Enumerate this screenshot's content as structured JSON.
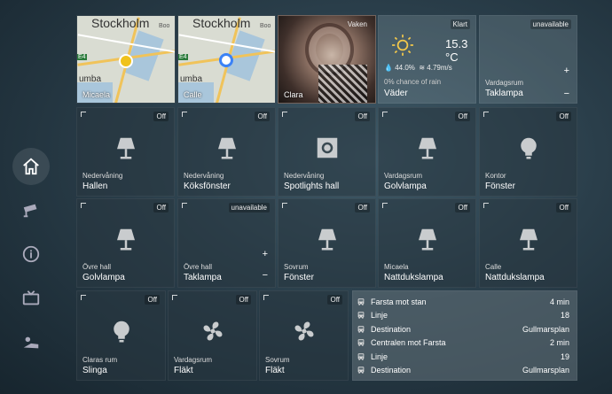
{
  "tiles": {
    "map1": {
      "label": "Micaela",
      "city": "Stockholm",
      "small": "Boo",
      "umba": "umba",
      "badge": "E4"
    },
    "map2": {
      "label": "Calle",
      "city": "Stockholm",
      "small": "Boo",
      "umba": "umba",
      "badge": "E4"
    },
    "camera": {
      "label": "Clara",
      "state": "Vaken"
    },
    "weather": {
      "state": "Klart",
      "temp": "15.3 °C",
      "humidity": "44.0%",
      "wind": "4.79m/s",
      "rain": "0% chance of rain",
      "name": "Väder"
    },
    "taklampa1": {
      "state": "unavailable",
      "sub": "Vardagsrum",
      "name": "Taklampa",
      "plus": "+",
      "minus": "−"
    },
    "r2": [
      {
        "state": "Off",
        "sub": "Nedervåning",
        "name": "Hallen",
        "icon": "floor-lamp-icon"
      },
      {
        "state": "Off",
        "sub": "Nedervåning",
        "name": "Köksfönster",
        "icon": "floor-lamp-icon"
      },
      {
        "state": "Off",
        "sub": "Nedervåning",
        "name": "Spotlights hall",
        "icon": "spotlight-icon"
      },
      {
        "state": "Off",
        "sub": "Vardagsrum",
        "name": "Golvlampa",
        "icon": "floor-lamp-icon"
      },
      {
        "state": "Off",
        "sub": "Kontor",
        "name": "Fönster",
        "icon": "bulb-icon"
      }
    ],
    "r3": [
      {
        "state": "Off",
        "sub": "Övre hall",
        "name": "Golvlampa",
        "icon": "floor-lamp-icon"
      },
      {
        "state": "unavailable",
        "sub": "Övre hall",
        "name": "Taklampa",
        "plus": "+",
        "minus": "−"
      },
      {
        "state": "Off",
        "sub": "Sovrum",
        "name": "Fönster",
        "icon": "floor-lamp-icon"
      },
      {
        "state": "Off",
        "sub": "Micaela",
        "name": "Nattdukslampa",
        "icon": "floor-lamp-icon"
      },
      {
        "state": "Off",
        "sub": "Calle",
        "name": "Nattdukslampa",
        "icon": "floor-lamp-icon"
      }
    ],
    "r4": [
      {
        "state": "Off",
        "sub": "Claras rum",
        "name": "Slinga",
        "icon": "bulb-icon"
      },
      {
        "state": "Off",
        "sub": "Vardagsrum",
        "name": "Fläkt",
        "icon": "fan-icon"
      },
      {
        "state": "Off",
        "sub": "Sovrum",
        "name": "Fläkt",
        "icon": "fan-icon"
      }
    ]
  },
  "transit": {
    "rows": [
      {
        "label": "Farsta mot stan",
        "value": "4 min",
        "icon": "bus-icon"
      },
      {
        "label": "Linje",
        "value": "18",
        "icon": "bus-icon"
      },
      {
        "label": "Destination",
        "value": "Gullmarsplan",
        "icon": "bus-icon"
      },
      {
        "label": "Centralen mot Farsta",
        "value": "2 min",
        "icon": "bus-icon"
      },
      {
        "label": "Linje",
        "value": "19",
        "icon": "bus-icon"
      },
      {
        "label": "Destination",
        "value": "Gullmarsplan",
        "icon": "bus-icon"
      }
    ]
  },
  "colors": {
    "lamp": "#c9ccce",
    "sun": "#f2c84b",
    "pin": "#f0c21b",
    "dot": "#3b82f6"
  }
}
